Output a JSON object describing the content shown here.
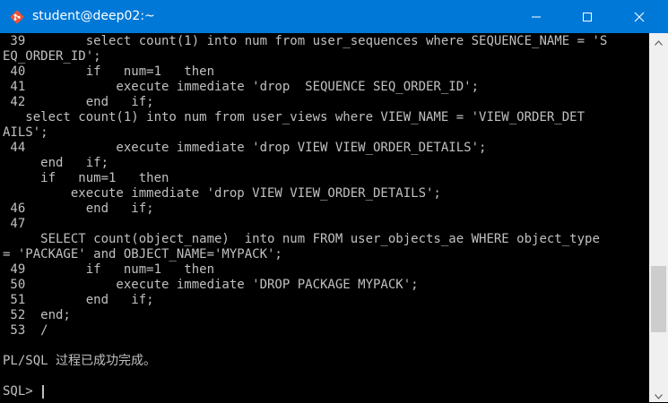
{
  "window": {
    "title": "student@deep02:~",
    "app_icon": "git-bash-icon",
    "controls": [
      "minimize-icon",
      "maximize-icon",
      "close-icon"
    ],
    "accent_color": "#0078d7"
  },
  "terminal": {
    "text_color": "#c0c0c0",
    "background_color": "#000000",
    "lines": [
      " 39        select count(1) into num from user_sequences where SEQUENCE_NAME = 'S",
      "EQ_ORDER_ID';",
      " 40        if   num=1   then",
      " 41            execute immediate 'drop  SEQUENCE SEQ_ORDER_ID';",
      " 42        end   if;",
      "   select count(1) into num from user_views where VIEW_NAME = 'VIEW_ORDER_DET",
      "AILS';",
      " 44            execute immediate 'drop VIEW VIEW_ORDER_DETAILS';",
      "     end   if;",
      "     if   num=1   then",
      "         execute immediate 'drop VIEW VIEW_ORDER_DETAILS';",
      " 46        end   if;",
      " 47",
      "     SELECT count(object_name)  into num FROM user_objects_ae WHERE object_type",
      "= 'PACKAGE' and OBJECT_NAME='MYPACK';",
      " 49        if   num=1   then",
      " 50            execute immediate 'DROP PACKAGE MYPACK';",
      " 51        end   if;",
      " 52  end;",
      " 53  /",
      "",
      "PL/SQL 过程已成功完成。",
      ""
    ],
    "prompt": "SQL> "
  },
  "scrollbar": {
    "position": 0.8
  }
}
